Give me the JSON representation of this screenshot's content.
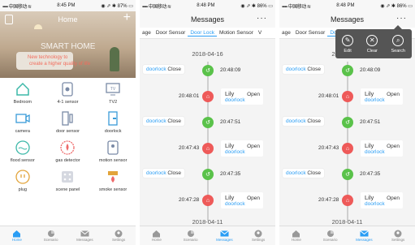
{
  "status": {
    "screen1": {
      "carrier": "中国移动",
      "time": "8:45 PM",
      "battery": "87%"
    },
    "screen2": {
      "carrier": "中国移动",
      "time": "8:48 PM",
      "battery": "86%"
    },
    "screen3": {
      "carrier": "中国移动",
      "time": "8:48 PM",
      "battery": "86%"
    }
  },
  "home": {
    "title": "Home",
    "hero_title": "SMART HOME",
    "hero_line1": "New technology to",
    "hero_line2": "create a higher quality of life",
    "devices": [
      {
        "label": "Bedroom",
        "icon": "house-icon"
      },
      {
        "label": "4-1 sensor",
        "icon": "sensor-icon"
      },
      {
        "label": "TV2",
        "icon": "tv-icon"
      },
      {
        "label": "camera",
        "icon": "camera-icon"
      },
      {
        "label": "door sensor",
        "icon": "door-sensor-icon"
      },
      {
        "label": "doorlock",
        "icon": "doorlock-icon"
      },
      {
        "label": "flood sensor",
        "icon": "flood-icon"
      },
      {
        "label": "gas detector",
        "icon": "gas-icon"
      },
      {
        "label": "motion sensor",
        "icon": "motion-icon"
      },
      {
        "label": "plug",
        "icon": "plug-icon"
      },
      {
        "label": "scene panel",
        "icon": "scene-panel-icon"
      },
      {
        "label": "smoke sensor",
        "icon": "smoke-icon"
      }
    ]
  },
  "messages": {
    "title": "Messages",
    "more": "···",
    "tabs": [
      "age",
      "Door Sensor",
      "Door Lock",
      "Motion Sensor",
      "V"
    ],
    "date_top": "2018-04-16",
    "date_bottom": "2018-04-11",
    "events": [
      {
        "side": "left",
        "device": "doorlock",
        "state": "Close",
        "time": "20:48:09"
      },
      {
        "side": "right",
        "who": "Lily",
        "device": "doorlock",
        "state": "Open",
        "time": "20:48:01"
      },
      {
        "side": "left",
        "device": "doorlock",
        "state": "Close",
        "time": "20:47:51"
      },
      {
        "side": "right",
        "who": "Lily",
        "device": "doorlock",
        "state": "Open",
        "time": "20:47:43"
      },
      {
        "side": "left",
        "device": "doorlock",
        "state": "Close",
        "time": "20:47:35"
      },
      {
        "side": "right",
        "who": "Lily",
        "device": "doorlock",
        "state": "Open",
        "time": "20:47:28"
      }
    ],
    "popup": {
      "edit": "Edit",
      "clear": "Clear",
      "search": "Search"
    }
  },
  "tabbar": [
    "Home",
    "Scenario",
    "Messages",
    "Settings"
  ],
  "colors": {
    "accent": "#2a9df4",
    "close_dot": "#5ac24a",
    "open_dot": "#ee5a59"
  }
}
